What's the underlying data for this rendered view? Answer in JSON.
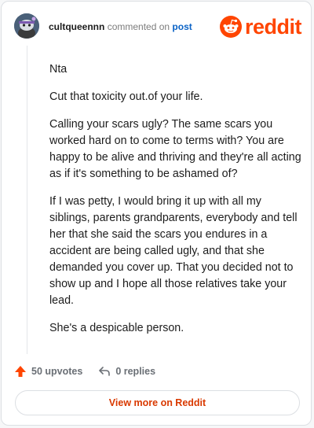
{
  "comment": {
    "username": "cultqueennn",
    "action_text": "commented on",
    "post_link": "post",
    "paragraphs": [
      "Nta",
      "Cut that toxicity out.of your life.",
      "Calling your scars ugly? The same scars you worked hard on to come to terms with? You are happy to be alive and thriving and they're all acting as if it's something to be ashamed of?",
      "If I was petty, I would bring it up with all my siblings, parents grandparents, everybody and tell her that she said the scars you endures in a accident are being called ugly, and that she demanded you cover up. That you decided not to show up and I hope all those relatives take your lead.",
      "She's a despicable person."
    ]
  },
  "brand": {
    "wordmark": "reddit",
    "color": "#ff4500"
  },
  "actions": {
    "upvotes": "50 upvotes",
    "replies": "0 replies"
  },
  "footer": {
    "view_more_label": "View more on Reddit"
  },
  "icons": [
    "avatar-snoo",
    "reddit-logo-icon",
    "upvote-arrow-icon",
    "reply-arrow-icon"
  ]
}
